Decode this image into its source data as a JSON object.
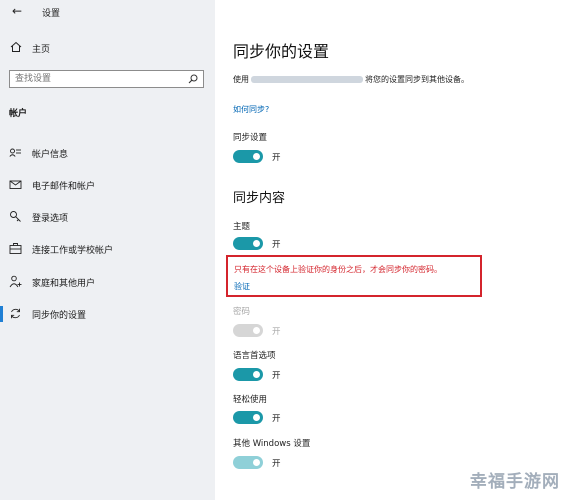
{
  "window": {
    "title": "设置"
  },
  "sidebar": {
    "home_label": "主页",
    "search_placeholder": "查找设置",
    "section_label": "帐户",
    "items": [
      {
        "label": "帐户信息",
        "icon": "account-info-icon"
      },
      {
        "label": "电子邮件和帐户",
        "icon": "mail-icon"
      },
      {
        "label": "登录选项",
        "icon": "key-icon"
      },
      {
        "label": "连接工作或学校帐户",
        "icon": "briefcase-icon"
      },
      {
        "label": "家庭和其他用户",
        "icon": "family-icon"
      },
      {
        "label": "同步你的设置",
        "icon": "sync-icon",
        "selected": true
      }
    ]
  },
  "main": {
    "title": "同步你的设置",
    "desc_prefix": "使用",
    "desc_suffix": "将您的设置同步到其他设备。",
    "how_sync_link": "如何同步?",
    "sync_setting": {
      "label": "同步设置",
      "state": "开",
      "on": true
    },
    "content_title": "同步内容",
    "items": [
      {
        "label": "主题",
        "state": "开",
        "on": true,
        "disabled": false
      },
      {
        "label": "密码",
        "state": "开",
        "on": true,
        "disabled": true
      },
      {
        "label": "语言首选项",
        "state": "开",
        "on": true,
        "disabled": false
      },
      {
        "label": "轻松使用",
        "state": "开",
        "on": true,
        "disabled": false
      },
      {
        "label": "其他 Windows 设置",
        "state": "开",
        "on": true,
        "disabled": false
      }
    ],
    "warning": {
      "text": "只有在这个设备上验证你的身份之后，才会同步你的密码。",
      "verify_link": "验证"
    }
  },
  "watermark": "幸福手游网",
  "colors": {
    "accent": "#1b98a8",
    "link": "#0066b4",
    "warning": "#d4242c",
    "sidebar_bg": "#eef0f3"
  }
}
